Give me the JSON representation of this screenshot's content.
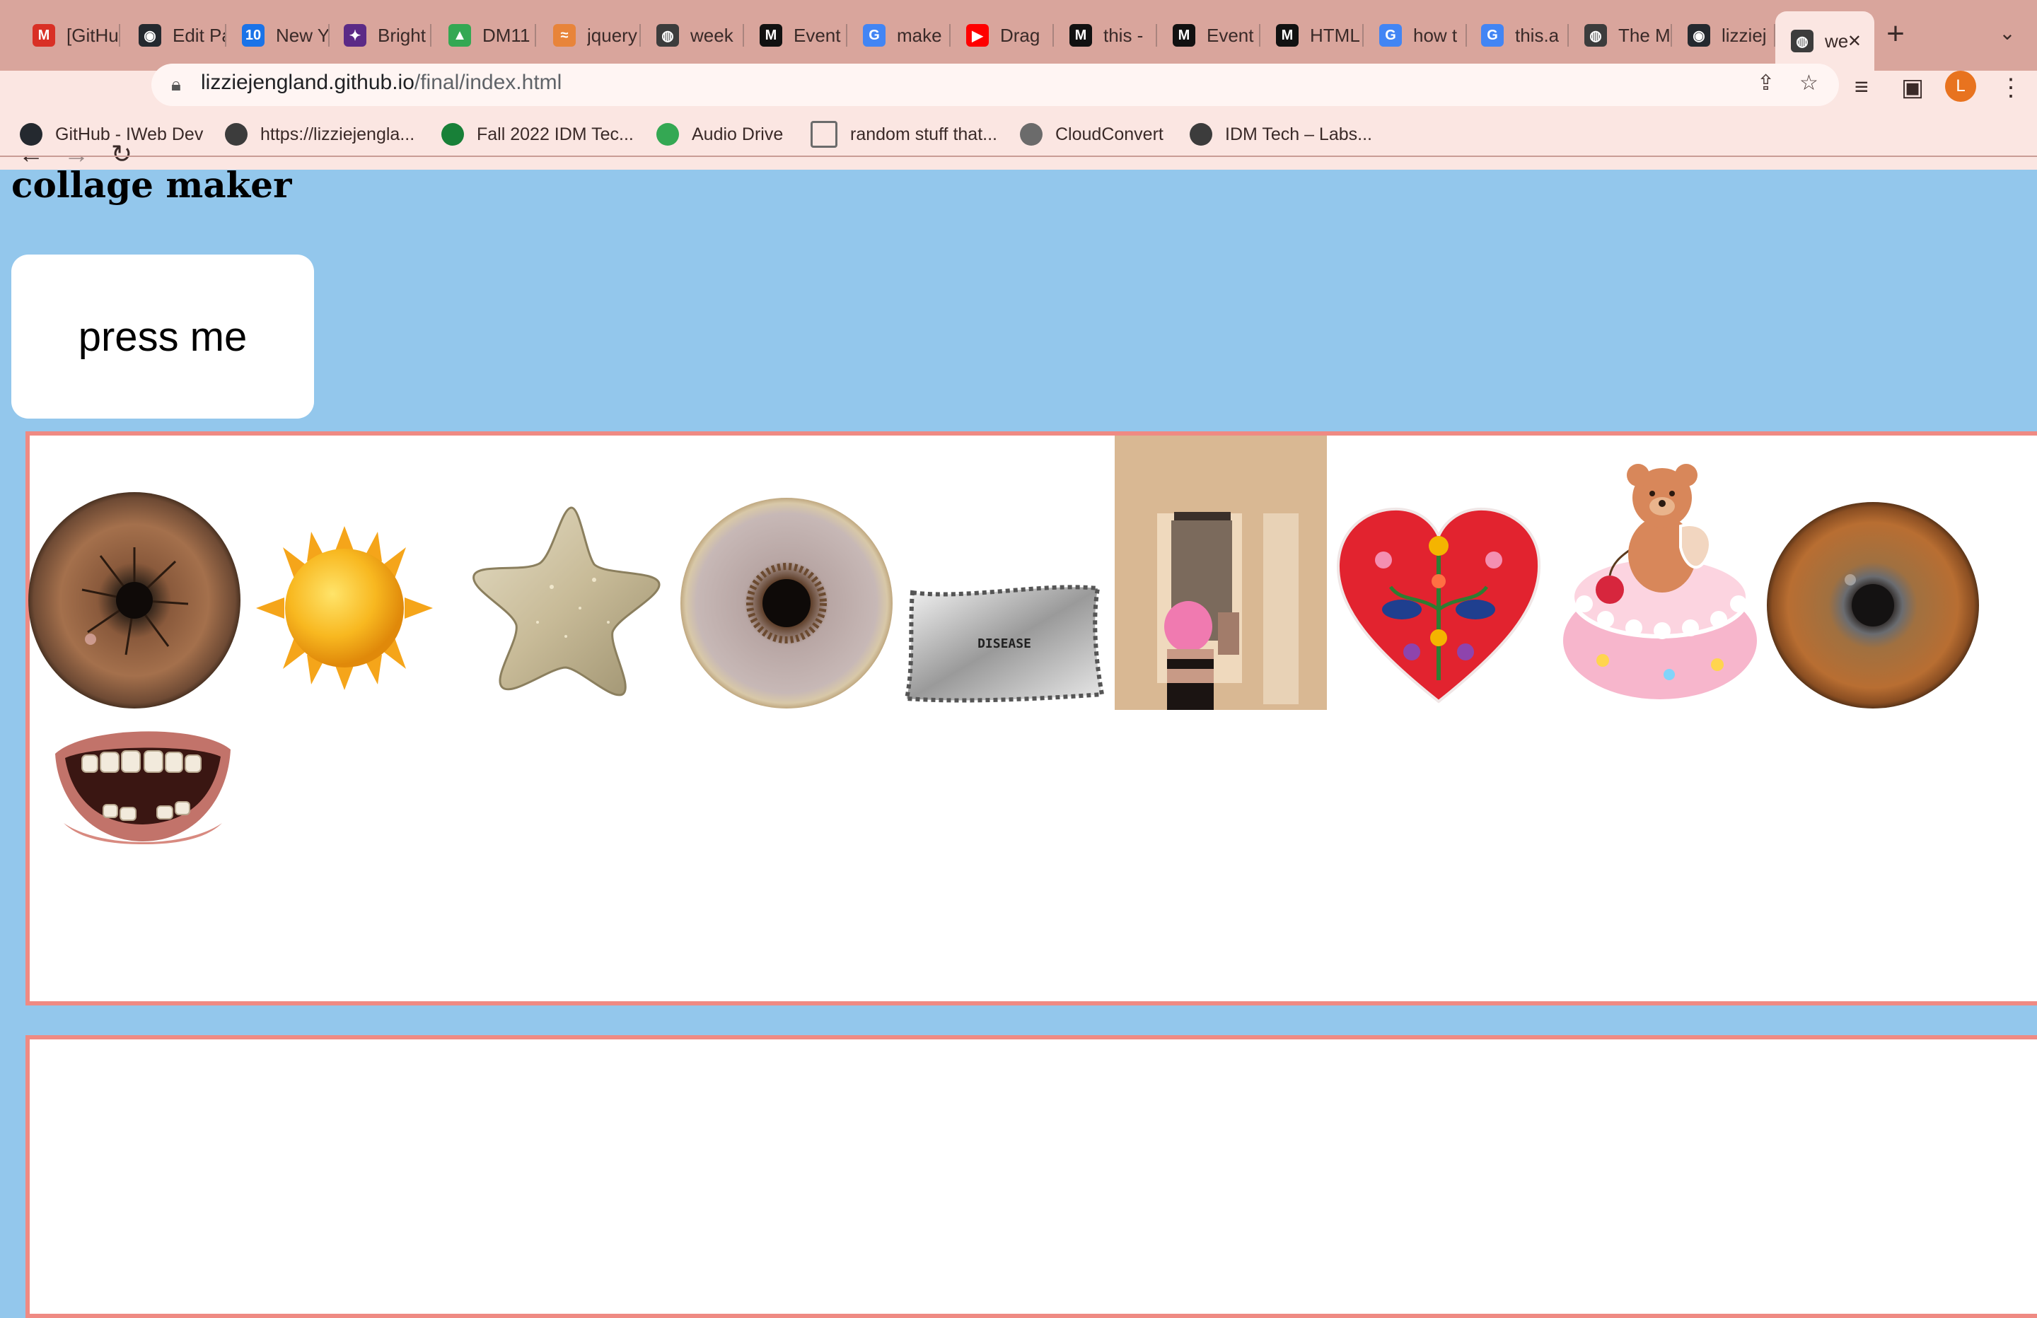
{
  "browser": {
    "tabs": [
      {
        "title": "[GitHub]",
        "icon": "gmail-icon",
        "color": "#d93025",
        "glyph": "M"
      },
      {
        "title": "Edit Page",
        "icon": "github-icon",
        "color": "#24292f",
        "glyph": "◉"
      },
      {
        "title": "New Year",
        "icon": "calendar-icon",
        "color": "#1a73e8",
        "glyph": "10"
      },
      {
        "title": "Bright",
        "icon": "bright-icon",
        "color": "#5b2a86",
        "glyph": "✦"
      },
      {
        "title": "DM11",
        "icon": "drive-icon",
        "color": "#34a853",
        "glyph": "▲"
      },
      {
        "title": "jquery",
        "icon": "jquery-icon",
        "color": "#e8843a",
        "glyph": "≈"
      },
      {
        "title": "week",
        "icon": "globe-icon",
        "color": "#3c3c3c",
        "glyph": "◍"
      },
      {
        "title": "Event",
        "icon": "mdn-icon",
        "color": "#111111",
        "glyph": "M"
      },
      {
        "title": "make",
        "icon": "google-icon",
        "color": "#4285f4",
        "glyph": "G"
      },
      {
        "title": "Drag",
        "icon": "youtube-icon",
        "color": "#ff0000",
        "glyph": "▶"
      },
      {
        "title": "this -",
        "icon": "mdn-icon",
        "color": "#111111",
        "glyph": "M"
      },
      {
        "title": "Event",
        "icon": "mdn-icon",
        "color": "#111111",
        "glyph": "M"
      },
      {
        "title": "HTML",
        "icon": "mdn-icon",
        "color": "#111111",
        "glyph": "M"
      },
      {
        "title": "how t",
        "icon": "google-icon",
        "color": "#4285f4",
        "glyph": "G"
      },
      {
        "title": "this.a",
        "icon": "google-icon",
        "color": "#4285f4",
        "glyph": "G"
      },
      {
        "title": "The M",
        "icon": "globe-icon",
        "color": "#3c3c3c",
        "glyph": "◍"
      },
      {
        "title": "lizziej",
        "icon": "github-icon",
        "color": "#24292f",
        "glyph": "◉"
      },
      {
        "title": "we",
        "icon": "globe-icon",
        "color": "#3c3c3c",
        "glyph": "◍"
      }
    ],
    "url_host": "lizziejengland.github.io",
    "url_path": "/final/index.html",
    "profile_initial": "L",
    "bookmarks": [
      {
        "label": "GitHub - IWeb Dev",
        "icon": "github-icon",
        "color": "#24292f"
      },
      {
        "label": "https://lizziejengla...",
        "icon": "globe-icon",
        "color": "#3c3c3c"
      },
      {
        "label": "Fall 2022 IDM Tec...",
        "icon": "sheets-icon",
        "color": "#188038"
      },
      {
        "label": "Audio Drive",
        "icon": "drive-icon",
        "color": "#34a853"
      },
      {
        "label": "random stuff that...",
        "icon": "folder-icon",
        "color": "#6b6b6b"
      },
      {
        "label": "CloudConvert",
        "icon": "cloud-icon",
        "color": "#6b6b6b"
      },
      {
        "label": "IDM Tech – Labs...",
        "icon": "globe-icon",
        "color": "#3c3c3c"
      }
    ]
  },
  "page": {
    "title": "collage maker",
    "button_label": "press me",
    "background": "#93c7ec",
    "border_color": "#ef8a83"
  },
  "stickers": [
    {
      "name": "eye-sticker-1",
      "kind": "eye"
    },
    {
      "name": "sun-sticker",
      "kind": "sun"
    },
    {
      "name": "star-sticker",
      "kind": "star"
    },
    {
      "name": "eye-sticker-2",
      "kind": "eye"
    },
    {
      "name": "disease-pillow-sticker",
      "kind": "pillow",
      "text": "DISEASE"
    },
    {
      "name": "pink-hair-photo-sticker",
      "kind": "photo"
    },
    {
      "name": "folk-heart-sticker",
      "kind": "heart"
    },
    {
      "name": "teddy-cake-sticker",
      "kind": "cake"
    },
    {
      "name": "eye-sticker-3",
      "kind": "eye"
    },
    {
      "name": "mouth-sticker",
      "kind": "mouth"
    }
  ]
}
